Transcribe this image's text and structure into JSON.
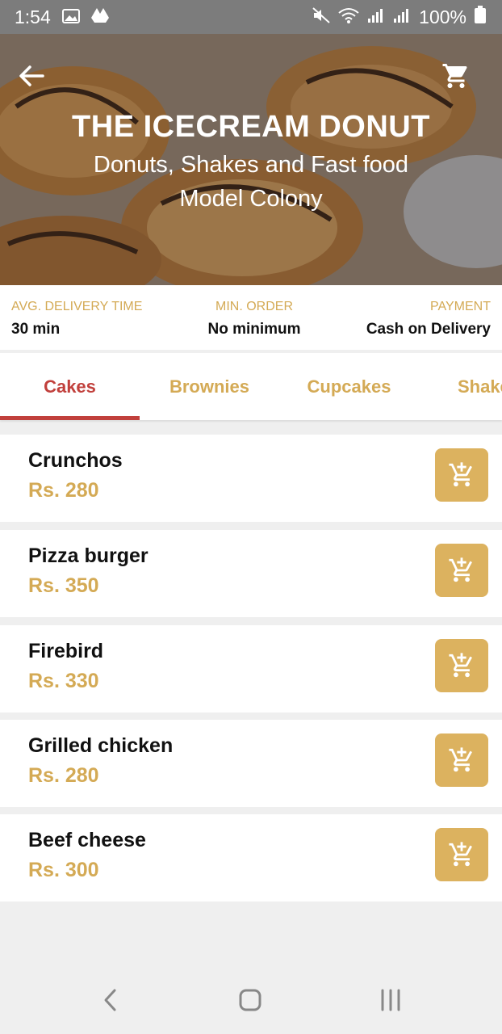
{
  "status_bar": {
    "time": "1:54",
    "battery": "100%"
  },
  "restaurant": {
    "name": "THE ICECREAM DONUT",
    "category": "Donuts, Shakes and Fast food",
    "location": "Model Colony"
  },
  "info": [
    {
      "label": "AVG. DELIVERY TIME",
      "value": "30 min"
    },
    {
      "label": "MIN. ORDER",
      "value": "No minimum"
    },
    {
      "label": "PAYMENT",
      "value": "Cash on Delivery"
    }
  ],
  "tabs": [
    {
      "label": "Cakes",
      "active": true
    },
    {
      "label": "Brownies",
      "active": false
    },
    {
      "label": "Cupcakes",
      "active": false
    },
    {
      "label": "Shakes",
      "active": false
    }
  ],
  "menu": [
    {
      "name": "Crunchos",
      "price": "Rs. 280"
    },
    {
      "name": "Pizza burger",
      "price": "Rs. 350"
    },
    {
      "name": "Firebird",
      "price": "Rs. 330"
    },
    {
      "name": "Grilled chicken",
      "price": "Rs. 280"
    },
    {
      "name": "Beef cheese",
      "price": "Rs. 300"
    }
  ],
  "colors": {
    "accent": "#d4aa55",
    "active_tab": "#c1403c",
    "button": "#dcb25f"
  },
  "icons": [
    "back-arrow-icon",
    "cart-icon",
    "add-to-cart-icon",
    "nav-back-icon",
    "nav-home-icon",
    "nav-recents-icon"
  ]
}
